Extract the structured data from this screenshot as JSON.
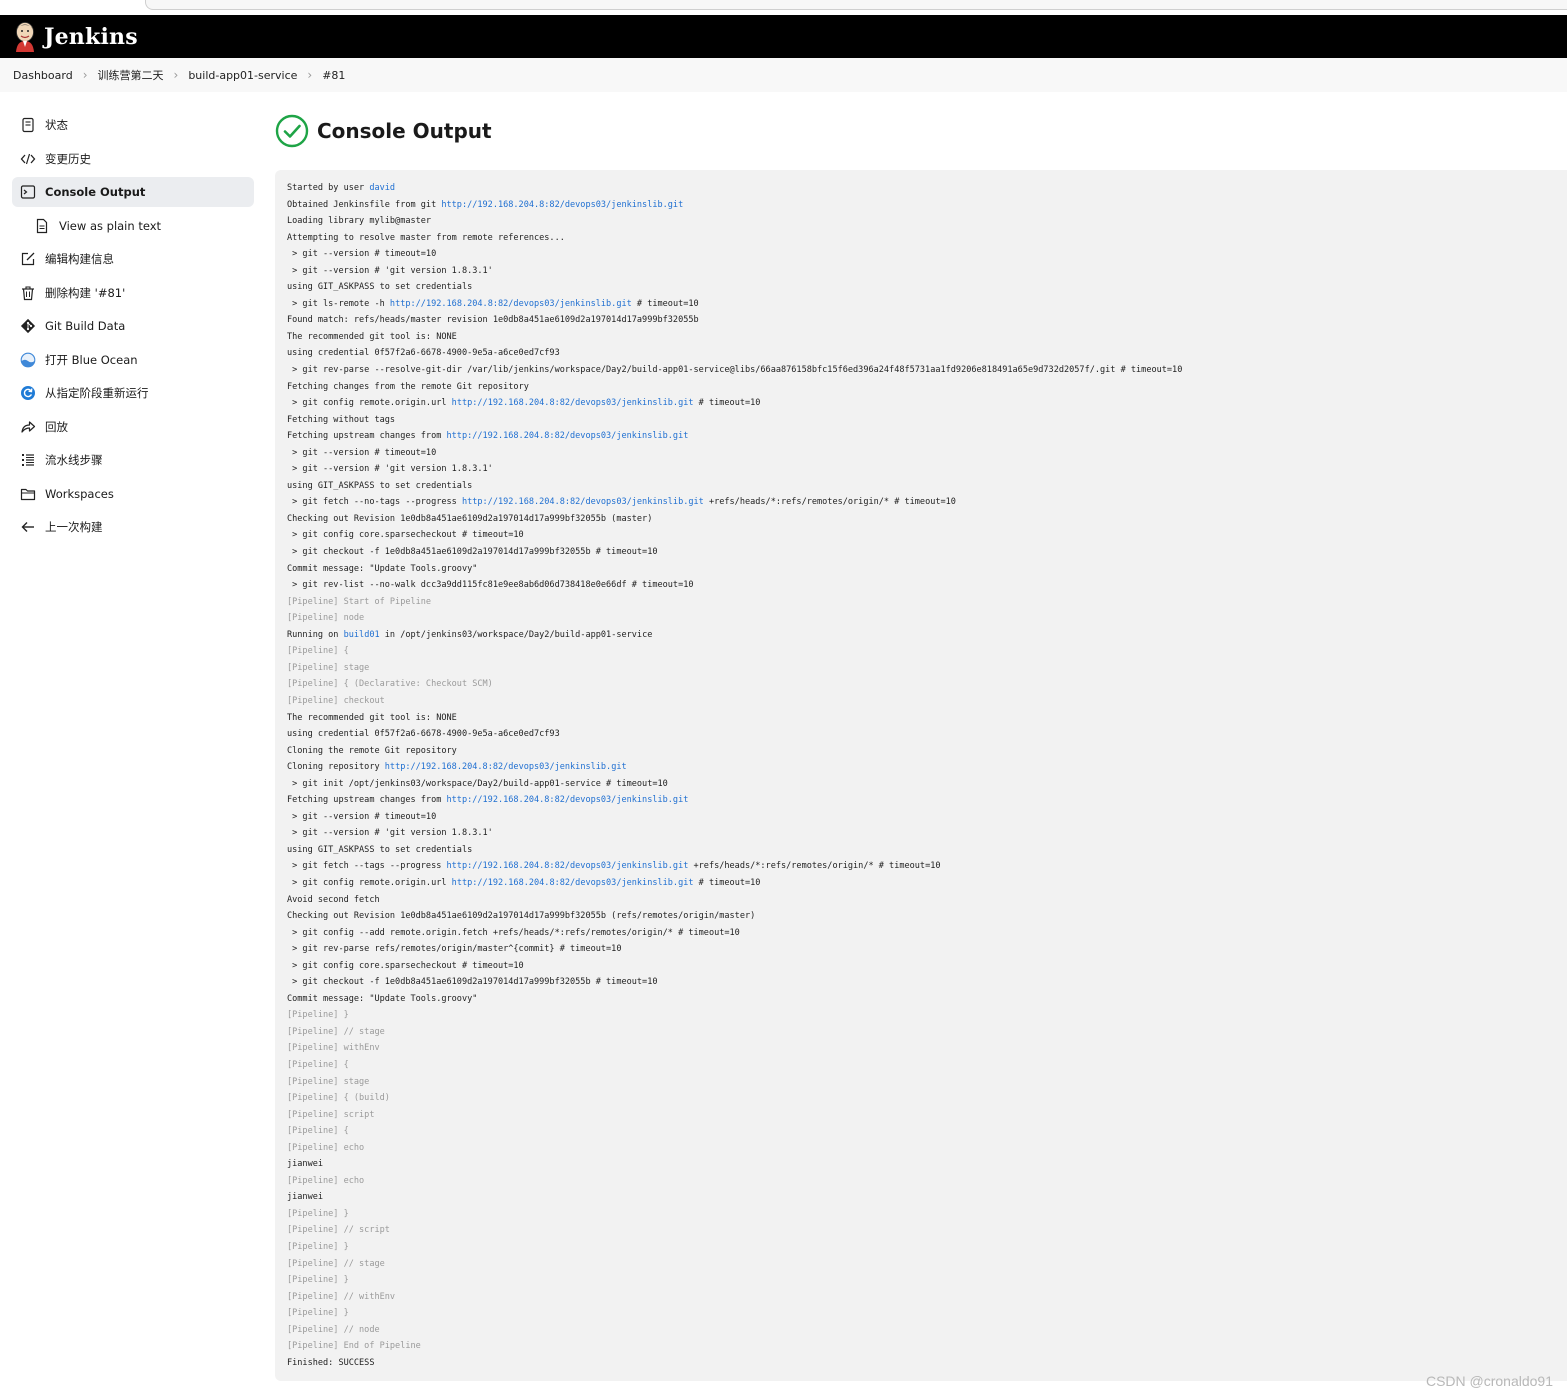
{
  "header": {
    "brand": "Jenkins"
  },
  "breadcrumb": [
    "Dashboard",
    "训练营第二天",
    "build-app01-service",
    "#81"
  ],
  "sidebar": {
    "items": [
      {
        "label": "状态",
        "icon": "document-icon"
      },
      {
        "label": "变更历史",
        "icon": "code-icon"
      },
      {
        "label": "Console Output",
        "icon": "terminal-icon",
        "active": true
      },
      {
        "label": "View as plain text",
        "icon": "file-icon",
        "sub": true
      },
      {
        "label": "编辑构建信息",
        "icon": "edit-icon"
      },
      {
        "label": "删除构建 '#81'",
        "icon": "trash-icon"
      },
      {
        "label": "Git Build Data",
        "icon": "git-icon"
      },
      {
        "label": "打开 Blue Ocean",
        "icon": "blue-ocean-icon"
      },
      {
        "label": "从指定阶段重新运行",
        "icon": "restart-icon"
      },
      {
        "label": "回放",
        "icon": "replay-icon"
      },
      {
        "label": "流水线步骤",
        "icon": "steps-icon"
      },
      {
        "label": "Workspaces",
        "icon": "folder-icon"
      },
      {
        "label": "上一次构建",
        "icon": "arrow-left-icon"
      }
    ]
  },
  "main": {
    "title": "Console Output",
    "status_icon": "success-check-icon"
  },
  "console": {
    "lines": [
      {
        "text": "Started by user ",
        "link": "david"
      },
      {
        "text": "Obtained Jenkinsfile from git ",
        "link": "http://192.168.204.8:82/devops03/jenkinslib.git"
      },
      {
        "text": "Loading library mylib@master"
      },
      {
        "text": "Attempting to resolve master from remote references..."
      },
      {
        "text": " > git --version # timeout=10"
      },
      {
        "text": " > git --version # 'git version 1.8.3.1'"
      },
      {
        "text": "using GIT_ASKPASS to set credentials"
      },
      {
        "text": " > git ls-remote -h ",
        "link": "http://192.168.204.8:82/devops03/jenkinslib.git",
        "after": " # timeout=10"
      },
      {
        "text": "Found match: refs/heads/master revision 1e0db8a451ae6109d2a197014d17a999bf32055b"
      },
      {
        "text": "The recommended git tool is: NONE"
      },
      {
        "text": "using credential 0f57f2a6-6678-4900-9e5a-a6ce0ed7cf93"
      },
      {
        "text": " > git rev-parse --resolve-git-dir /var/lib/jenkins/workspace/Day2/build-app01-service@libs/66aa876158bfc15f6ed396a24f48f5731aa1fd9206e818491a65e9d732d2057f/.git # timeout=10"
      },
      {
        "text": "Fetching changes from the remote Git repository"
      },
      {
        "text": " > git config remote.origin.url ",
        "link": "http://192.168.204.8:82/devops03/jenkinslib.git",
        "after": " # timeout=10"
      },
      {
        "text": "Fetching without tags"
      },
      {
        "text": "Fetching upstream changes from ",
        "link": "http://192.168.204.8:82/devops03/jenkinslib.git"
      },
      {
        "text": " > git --version # timeout=10"
      },
      {
        "text": " > git --version # 'git version 1.8.3.1'"
      },
      {
        "text": "using GIT_ASKPASS to set credentials"
      },
      {
        "text": " > git fetch --no-tags --progress ",
        "link": "http://192.168.204.8:82/devops03/jenkinslib.git",
        "after": " +refs/heads/*:refs/remotes/origin/* # timeout=10"
      },
      {
        "text": "Checking out Revision 1e0db8a451ae6109d2a197014d17a999bf32055b (master)"
      },
      {
        "text": " > git config core.sparsecheckout # timeout=10"
      },
      {
        "text": " > git checkout -f 1e0db8a451ae6109d2a197014d17a999bf32055b # timeout=10"
      },
      {
        "text": "Commit message: \"Update Tools.groovy\""
      },
      {
        "text": " > git rev-list --no-walk dcc3a9dd115fc81e9ee8ab6d06d738418e0e66df # timeout=10"
      },
      {
        "text": "[Pipeline] Start of Pipeline",
        "pipe": true
      },
      {
        "text": "[Pipeline] node",
        "pipe": true
      },
      {
        "text": "Running on ",
        "link": "build01",
        "after": " in /opt/jenkins03/workspace/Day2/build-app01-service"
      },
      {
        "text": "[Pipeline] {",
        "pipe": true
      },
      {
        "text": "[Pipeline] stage",
        "pipe": true
      },
      {
        "text": "[Pipeline] { (Declarative: Checkout SCM)",
        "pipe": true
      },
      {
        "text": "[Pipeline] checkout",
        "pipe": true
      },
      {
        "text": "The recommended git tool is: NONE"
      },
      {
        "text": "using credential 0f57f2a6-6678-4900-9e5a-a6ce0ed7cf93"
      },
      {
        "text": "Cloning the remote Git repository"
      },
      {
        "text": "Cloning repository ",
        "link": "http://192.168.204.8:82/devops03/jenkinslib.git"
      },
      {
        "text": " > git init /opt/jenkins03/workspace/Day2/build-app01-service # timeout=10"
      },
      {
        "text": "Fetching upstream changes from ",
        "link": "http://192.168.204.8:82/devops03/jenkinslib.git"
      },
      {
        "text": " > git --version # timeout=10"
      },
      {
        "text": " > git --version # 'git version 1.8.3.1'"
      },
      {
        "text": "using GIT_ASKPASS to set credentials"
      },
      {
        "text": " > git fetch --tags --progress ",
        "link": "http://192.168.204.8:82/devops03/jenkinslib.git",
        "after": " +refs/heads/*:refs/remotes/origin/* # timeout=10"
      },
      {
        "text": " > git config remote.origin.url ",
        "link": "http://192.168.204.8:82/devops03/jenkinslib.git",
        "after": " # timeout=10"
      },
      {
        "text": "Avoid second fetch"
      },
      {
        "text": "Checking out Revision 1e0db8a451ae6109d2a197014d17a999bf32055b (refs/remotes/origin/master)"
      },
      {
        "text": " > git config --add remote.origin.fetch +refs/heads/*:refs/remotes/origin/* # timeout=10"
      },
      {
        "text": " > git rev-parse refs/remotes/origin/master^{commit} # timeout=10"
      },
      {
        "text": " > git config core.sparsecheckout # timeout=10"
      },
      {
        "text": " > git checkout -f 1e0db8a451ae6109d2a197014d17a999bf32055b # timeout=10"
      },
      {
        "text": "Commit message: \"Update Tools.groovy\""
      },
      {
        "text": "[Pipeline] }",
        "pipe": true
      },
      {
        "text": "[Pipeline] // stage",
        "pipe": true
      },
      {
        "text": "[Pipeline] withEnv",
        "pipe": true
      },
      {
        "text": "[Pipeline] {",
        "pipe": true
      },
      {
        "text": "[Pipeline] stage",
        "pipe": true
      },
      {
        "text": "[Pipeline] { (build)",
        "pipe": true
      },
      {
        "text": "[Pipeline] script",
        "pipe": true
      },
      {
        "text": "[Pipeline] {",
        "pipe": true
      },
      {
        "text": "[Pipeline] echo",
        "pipe": true
      },
      {
        "text": "jianwei"
      },
      {
        "text": "[Pipeline] echo",
        "pipe": true
      },
      {
        "text": "jianwei"
      },
      {
        "text": "[Pipeline] }",
        "pipe": true
      },
      {
        "text": "[Pipeline] // script",
        "pipe": true
      },
      {
        "text": "[Pipeline] }",
        "pipe": true
      },
      {
        "text": "[Pipeline] // stage",
        "pipe": true
      },
      {
        "text": "[Pipeline] }",
        "pipe": true
      },
      {
        "text": "[Pipeline] // withEnv",
        "pipe": true
      },
      {
        "text": "[Pipeline] }",
        "pipe": true
      },
      {
        "text": "[Pipeline] // node",
        "pipe": true
      },
      {
        "text": "[Pipeline] End of Pipeline",
        "pipe": true
      },
      {
        "text": "Finished: SUCCESS"
      }
    ]
  },
  "watermark": "CSDN @cronaldo91",
  "colors": {
    "header_bg": "#000000",
    "link": "#1f6fd1",
    "success": "#1ea446",
    "console_bg": "#f2f2f2",
    "pipeline_text": "#9a9a9a"
  }
}
